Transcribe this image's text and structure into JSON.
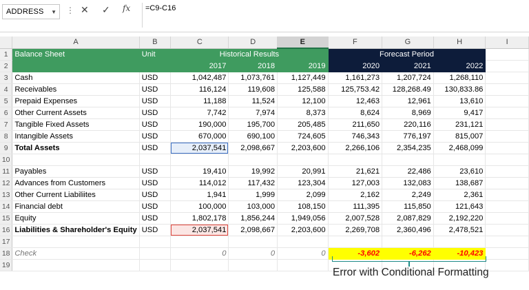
{
  "formula_bar": {
    "name_box": "ADDRESS",
    "formula": "=C9-C16",
    "icons": [
      "dropdown-icon",
      "more-icon",
      "cancel-icon",
      "enter-check-icon",
      "fx-icon"
    ],
    "cancel_glyph": "✕",
    "enter_glyph": "✓",
    "fx_glyph": "fx",
    "dots_glyph": "⋮",
    "arrow_glyph": "▼"
  },
  "columns": [
    "A",
    "B",
    "C",
    "D",
    "E",
    "F",
    "G",
    "H",
    "I"
  ],
  "selected_column": "E",
  "header": {
    "balance_sheet": "Balance Sheet",
    "unit": "Unit",
    "historical": "Historical Results",
    "forecast": "Forecast Period",
    "years": [
      "2017",
      "2018",
      "2019",
      "2020",
      "2021",
      "2022"
    ]
  },
  "rows": [
    {
      "n": "3",
      "label": "Cash",
      "unit": "USD",
      "vals": [
        "1,042,487",
        "1,073,761",
        "1,127,449",
        "1,161,273",
        "1,207,724",
        "1,268,110"
      ]
    },
    {
      "n": "4",
      "label": "Receivables",
      "unit": "USD",
      "vals": [
        "116,124",
        "119,608",
        "125,588",
        "125,753.42",
        "128,268.49",
        "130,833.86"
      ]
    },
    {
      "n": "5",
      "label": "Prepaid Expenses",
      "unit": "USD",
      "vals": [
        "11,188",
        "11,524",
        "12,100",
        "12,463",
        "12,961",
        "13,610"
      ]
    },
    {
      "n": "6",
      "label": "Other Current Assets",
      "unit": "USD",
      "vals": [
        "7,742",
        "7,974",
        "8,373",
        "8,624",
        "8,969",
        "9,417"
      ]
    },
    {
      "n": "7",
      "label": "Tangible Fixed Assets",
      "unit": "USD",
      "vals": [
        "190,000",
        "195,700",
        "205,485",
        "211,650",
        "220,116",
        "231,121"
      ]
    },
    {
      "n": "8",
      "label": "Intangible Assets",
      "unit": "USD",
      "vals": [
        "670,000",
        "690,100",
        "724,605",
        "746,343",
        "776,197",
        "815,007"
      ]
    },
    {
      "n": "9",
      "label": "Total Assets",
      "unit": "USD",
      "vals": [
        "2,037,541",
        "2,098,667",
        "2,203,600",
        "2,266,106",
        "2,354,235",
        "2,468,099"
      ]
    },
    {
      "n": "10",
      "label": "",
      "unit": "",
      "vals": [
        "",
        "",
        "",
        "",
        "",
        ""
      ]
    },
    {
      "n": "11",
      "label": "Payables",
      "unit": "USD",
      "vals": [
        "19,410",
        "19,992",
        "20,991",
        "21,621",
        "22,486",
        "23,610"
      ]
    },
    {
      "n": "12",
      "label": "Advances from Customers",
      "unit": "USD",
      "vals": [
        "114,012",
        "117,432",
        "123,304",
        "127,003",
        "132,083",
        "138,687"
      ]
    },
    {
      "n": "13",
      "label": "Other Current Liabiliites",
      "unit": "USD",
      "vals": [
        "1,941",
        "1,999",
        "2,099",
        "2,162",
        "2,249",
        "2,361"
      ]
    },
    {
      "n": "14",
      "label": "Financial debt",
      "unit": "USD",
      "vals": [
        "100,000",
        "103,000",
        "108,150",
        "111,395",
        "115,850",
        "121,643"
      ]
    },
    {
      "n": "15",
      "label": "Equity",
      "unit": "USD",
      "vals": [
        "1,802,178",
        "1,856,244",
        "1,949,056",
        "2,007,528",
        "2,087,829",
        "2,192,220"
      ]
    },
    {
      "n": "16",
      "label": "Liabilities & Shareholder's Equity",
      "unit": "USD",
      "vals": [
        "2,037,541",
        "2,098,667",
        "2,203,600",
        "2,269,708",
        "2,360,496",
        "2,478,521"
      ]
    },
    {
      "n": "17",
      "label": "",
      "unit": "",
      "vals": [
        "",
        "",
        "",
        "",
        "",
        ""
      ]
    },
    {
      "n": "18",
      "label": "Check",
      "unit": "",
      "vals": [
        "0",
        "0",
        "0",
        "-3,602",
        "-6,262",
        "-10,423"
      ]
    },
    {
      "n": "19",
      "label": "",
      "unit": "",
      "vals": [
        "",
        "",
        "",
        "",
        "",
        ""
      ]
    }
  ],
  "header_row_numbers": [
    "1",
    "2"
  ],
  "annotation": "Error with Conditional Formatting",
  "colors": {
    "historical_header": "#3f9b5f",
    "forecast_header": "#0d1c3a",
    "check_error_fill": "#ffff00",
    "check_error_text": "#ff0000",
    "selected_col_accent": "#217346"
  }
}
